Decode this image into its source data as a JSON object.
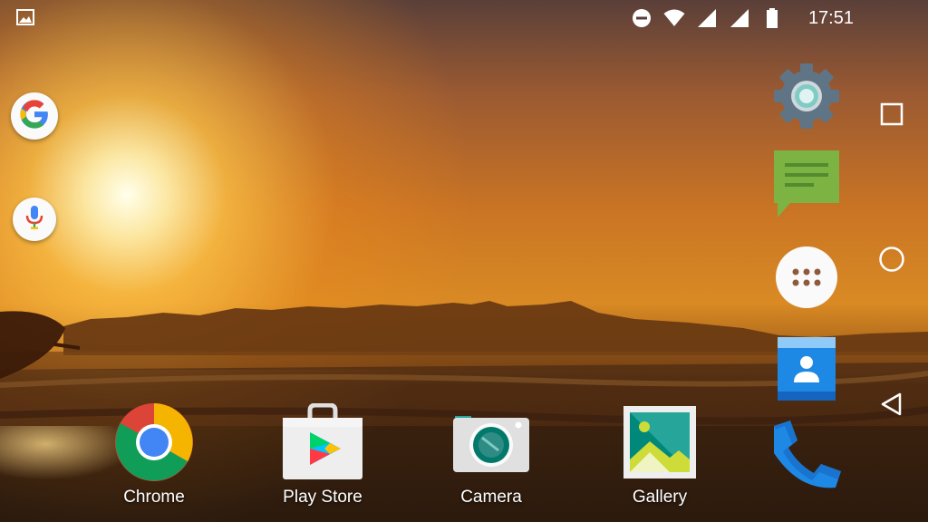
{
  "status_bar": {
    "time": "17:51",
    "icons": [
      "gallery-notification-icon",
      "do-not-disturb-icon",
      "wifi-icon",
      "signal-icon",
      "signal-icon",
      "battery-icon"
    ]
  },
  "search": {
    "google_icon": "google-g-icon",
    "voice_icon": "microphone-icon"
  },
  "dock": {
    "apps": [
      {
        "name": "Settings",
        "icon": "settings-gear-icon"
      },
      {
        "name": "Messaging",
        "icon": "message-bubble-icon"
      },
      {
        "name": "All apps",
        "icon": "app-drawer-icon"
      },
      {
        "name": "Contacts",
        "icon": "contacts-icon"
      },
      {
        "name": "Phone",
        "icon": "phone-icon"
      }
    ]
  },
  "home_apps": [
    {
      "label": "Chrome",
      "icon": "chrome-icon"
    },
    {
      "label": "Play Store",
      "icon": "play-store-icon"
    },
    {
      "label": "Camera",
      "icon": "camera-icon"
    },
    {
      "label": "Gallery",
      "icon": "gallery-icon"
    }
  ],
  "navigation": {
    "buttons": [
      "recents-icon",
      "home-icon",
      "back-icon"
    ]
  },
  "colors": {
    "settings_gray": "#5f7585",
    "messaging_green": "#7cb342",
    "contacts_blue": "#1e88e5",
    "phone_blue": "#1e88e5",
    "camera_teal": "#2e8c84",
    "gallery_teal": "#26a69a"
  }
}
